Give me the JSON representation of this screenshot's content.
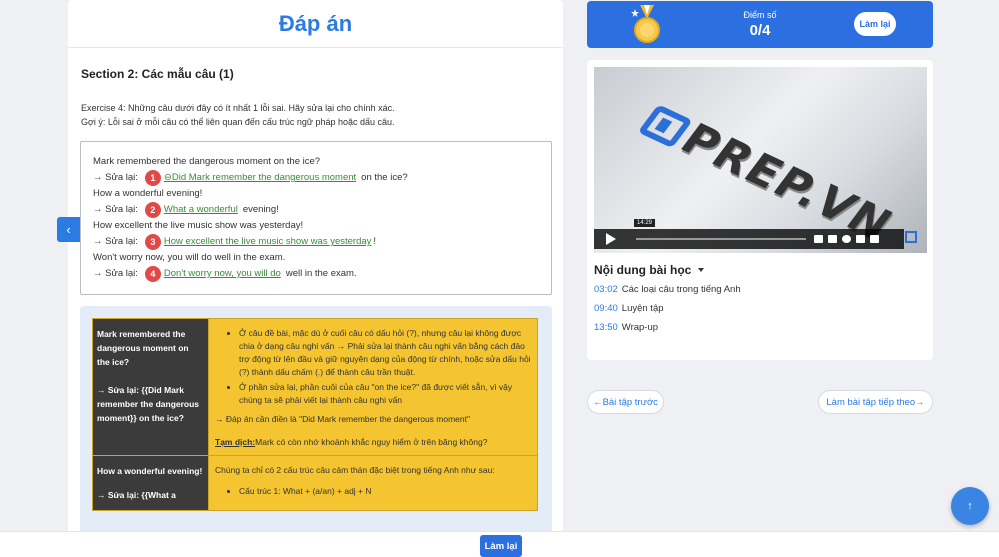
{
  "answer_panel": {
    "title": "Đáp án",
    "section_title": "Section 2: Các mẫu câu (1)",
    "instruction_line1": "Exercise 4: Những câu dưới đây có ít nhất 1 lỗi sai. Hãy sửa lại cho chính xác.",
    "instruction_line2": "Gợi ý: Lỗi sai ở mỗi câu có thể liên quan đến cấu trúc ngữ pháp hoặc dấu câu."
  },
  "exercise": {
    "fix_prefix": "→ Sửa lại:",
    "items": [
      {
        "sentence": "Mark remembered the dangerous moment on the ice?",
        "num": "1",
        "answer": "Did Mark remember the dangerous moment",
        "suffix": "on the ice?"
      },
      {
        "sentence": "How a wonderful evening!",
        "num": "2",
        "answer": "What a wonderful",
        "suffix": "evening!"
      },
      {
        "sentence": "How excellent the live music show was yesterday!",
        "num": "3",
        "answer": "How excellent the live music show was yesterday",
        "suffix": "!"
      },
      {
        "sentence": "Won't worry now, you will do well in the exam.",
        "num": "4",
        "answer": "Don't worry now, you will do",
        "suffix": "well in the exam."
      }
    ]
  },
  "explanation": {
    "row1_left": [
      "Mark remembered the",
      "dangerous moment on",
      "the ice?",
      "",
      "→ Sửa lại: {{Did Mark",
      "remember the dangerous",
      "moment}} on the ice?"
    ],
    "row1_bullets": [
      "Ở câu đề bài, mặc dù ở cuối câu có dấu hỏi (?), nhưng câu lại không được chia ở dạng câu nghi vấn → Phải sửa lại thành câu nghi vấn bằng cách đảo trợ động từ lên đầu và giữ nguyên dạng của động từ chính, hoặc sửa dấu hỏi (?) thành dấu chấm (.) để thành câu trần thuật.",
      "Ở phần sửa lại, phần cuối của câu \"on the ice?\" đã được viết sẵn, vì vậy chúng ta sẽ phải viết lại thành câu nghi vấn"
    ],
    "row1_answer": "→ Đáp án cần điền là \"Did Mark remember the dangerous moment\"",
    "row1_trans_label": "Tạm dịch:",
    "row1_trans": "Mark có còn nhớ khoảnh khắc nguy hiểm ở trên băng không?",
    "row2_left": [
      "How a wonderful evening!",
      "",
      "→ Sửa lại: {{What a"
    ],
    "row2_intro": "Chúng ta chỉ có 2 cấu trúc câu cảm thán đặc biệt trong tiếng Anh như sau:",
    "row2_bullets": [
      "Cấu trúc 1: What + (a/an) + adj + N"
    ]
  },
  "score": {
    "label": "Điểm số",
    "value": "0/4",
    "retry_label": "Làm lại"
  },
  "video": {
    "logo_text": "PREP.VN",
    "time_tooltip": "14:29"
  },
  "lesson": {
    "heading": "Nội dung bài học",
    "chapters": [
      {
        "time": "03:02",
        "title": "Các loại câu trong tiếng Anh"
      },
      {
        "time": "09:40",
        "title": "Luyện tập"
      },
      {
        "time": "13:50",
        "title": "Wrap-up"
      }
    ]
  },
  "nav": {
    "prev_label": "←Bài tập trước",
    "next_label": "Làm bài tập tiếp theo→"
  },
  "bottom": {
    "retry_label": "Làm lại"
  },
  "icons": {
    "side_arrow": "chevron-left-icon",
    "fab": "arrow-up-icon",
    "medal": "medal-icon"
  },
  "colors": {
    "primary": "#2b7be3",
    "score_bg": "#2c6fe0",
    "highlight": "#f4c530",
    "error_badge": "#e34848",
    "answer_green": "#3a8a3a"
  }
}
